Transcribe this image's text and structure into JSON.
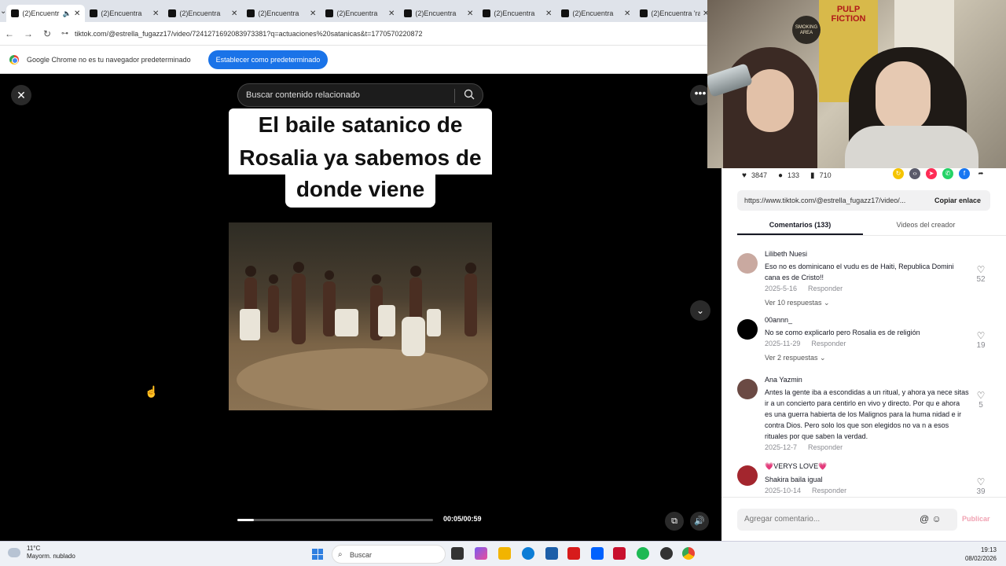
{
  "browser": {
    "tabs": [
      {
        "label": "(2)Encuentr",
        "active": true
      },
      {
        "label": "(2)Encuentra"
      },
      {
        "label": "(2)Encuentra"
      },
      {
        "label": "(2)Encuentra"
      },
      {
        "label": "(2)Encuentra"
      },
      {
        "label": "(2)Encuentra"
      },
      {
        "label": "(2)Encuentra"
      },
      {
        "label": "(2)Encuentra"
      },
      {
        "label": "(2)Encuentra 'ra"
      }
    ],
    "url": "tiktok.com/@estrella_fugazz17/video/7241271692083973381?q=actuaciones%20satanicas&t=1770570220872",
    "infobar_text": "Google Chrome no es tu navegador predeterminado",
    "infobar_button": "Establecer como predeterminado"
  },
  "viewer": {
    "search_placeholder": "Buscar contenido relacionado",
    "caption_lines": [
      "El baile satanico de",
      "Rosalia ya sabemos de",
      "donde viene"
    ],
    "time": "00:05/00:59",
    "progress": 0.085
  },
  "webcam": {
    "poster_title": "PULP FICTION",
    "badge_text": "SMOKING AREA"
  },
  "panel": {
    "likes": "3847",
    "comments_count": "133",
    "saves": "710",
    "link": "https://www.tiktok.com/@estrella_fugazz17/video/...",
    "copy_label": "Copiar enlace",
    "tab_comments": "Comentarios (133)",
    "tab_videos": "Videos del creador",
    "comments": [
      {
        "name": "Lilibeth Nuesi",
        "text": "Eso no es dominicano el vudu es de Haiti, Republica Domini cana es de Cristo!!",
        "date": "2025-5-16",
        "reply": "Responder",
        "likes": "52",
        "replies": "Ver 10 respuestas",
        "avatar_color": "#c9a9a0"
      },
      {
        "name": "00annn_",
        "text": "No se como explicarlo pero Rosalia es de religión",
        "date": "2025-11-29",
        "reply": "Responder",
        "likes": "19",
        "replies": "Ver 2 respuestas",
        "avatar_color": "#000000"
      },
      {
        "name": "Ana Yazmin",
        "text": "Antes la gente iba a escondidas a un ritual, y ahora ya nece sitas ir a un concierto para centirlo en vivo y directo. Por qu e ahora es una guerra habierta de los Malignos para la huma nidad e ir contra Dios. Pero solo los que son elegidos no va n a esos rituales por que saben la verdad.",
        "date": "2025-12-7",
        "reply": "Responder",
        "likes": "5",
        "replies": "",
        "avatar_color": "#6b4a44"
      },
      {
        "name": "💗VERYS LOVE💗",
        "text": "Shakira baila igual",
        "date": "2025-10-14",
        "reply": "Responder",
        "likes": "39",
        "replies": "",
        "avatar_color": "#a3262e"
      }
    ],
    "composer_placeholder": "Agregar comentario...",
    "publish_label": "Publicar"
  },
  "taskbar": {
    "temp": "11°C",
    "weather": "Mayorm. nublado",
    "search": "Buscar",
    "time": "19:13",
    "date": "08/02/2026"
  }
}
